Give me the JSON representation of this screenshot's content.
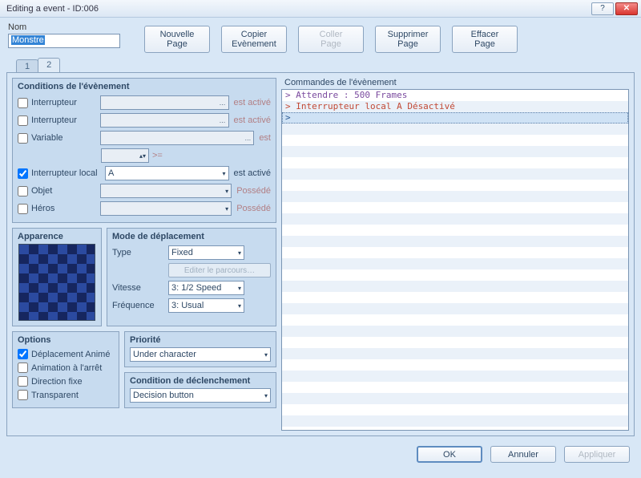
{
  "window": {
    "title": "Editing a event - ID:006"
  },
  "name": {
    "label": "Nom",
    "value": "Monstre"
  },
  "topButtons": {
    "newPage": "Nouvelle\nPage",
    "copyEvt": "Copier\nEvènement",
    "pastePage": "Coller\nPage",
    "delPage": "Supprimer\nPage",
    "clearPage": "Effacer\nPage"
  },
  "tabs": [
    "1",
    "2"
  ],
  "conditions": {
    "title": "Conditions de l'évènement",
    "switch1": {
      "label": "Interrupteur",
      "value": "",
      "suffix": "est activé",
      "checked": false
    },
    "switch2": {
      "label": "Interrupteur",
      "value": "",
      "suffix": "est activé",
      "checked": false
    },
    "variable": {
      "label": "Variable",
      "value": "",
      "suffix": "est",
      "checked": false,
      "cmp": ">=",
      "num": ""
    },
    "localSw": {
      "label": "Interrupteur local",
      "value": "A",
      "suffix": "est activé",
      "checked": true
    },
    "item": {
      "label": "Objet",
      "value": "",
      "suffix": "Possédé",
      "checked": false
    },
    "hero": {
      "label": "Héros",
      "value": "",
      "suffix": "Possédé",
      "checked": false
    }
  },
  "appearance": {
    "title": "Apparence"
  },
  "move": {
    "title": "Mode de déplacement",
    "type": {
      "label": "Type",
      "value": "Fixed"
    },
    "editRoute": "Editer le parcours…",
    "speed": {
      "label": "Vitesse",
      "value": "3: 1/2 Speed"
    },
    "freq": {
      "label": "Fréquence",
      "value": "3: Usual"
    }
  },
  "options": {
    "title": "Options",
    "moveAnim": {
      "label": "Déplacement Animé",
      "checked": true
    },
    "stopAnim": {
      "label": "Animation à l'arrêt",
      "checked": false
    },
    "dirFix": {
      "label": "Direction fixe",
      "checked": false
    },
    "transparent": {
      "label": "Transparent",
      "checked": false
    }
  },
  "priority": {
    "title": "Priorité",
    "value": "Under character"
  },
  "trigger": {
    "title": "Condition de déclenchement",
    "value": "Decision button"
  },
  "commands": {
    "title": "Commandes de l'évènement",
    "lines": [
      {
        "text": "> Attendre : 500 Frames",
        "color": "#7a4a9e"
      },
      {
        "text": "> Interrupteur local A Désactivé",
        "color": "#c24a36"
      },
      {
        "text": ">",
        "color": "#2a5a94",
        "selected": true
      }
    ]
  },
  "footer": {
    "ok": "OK",
    "cancel": "Annuler",
    "apply": "Appliquer"
  }
}
